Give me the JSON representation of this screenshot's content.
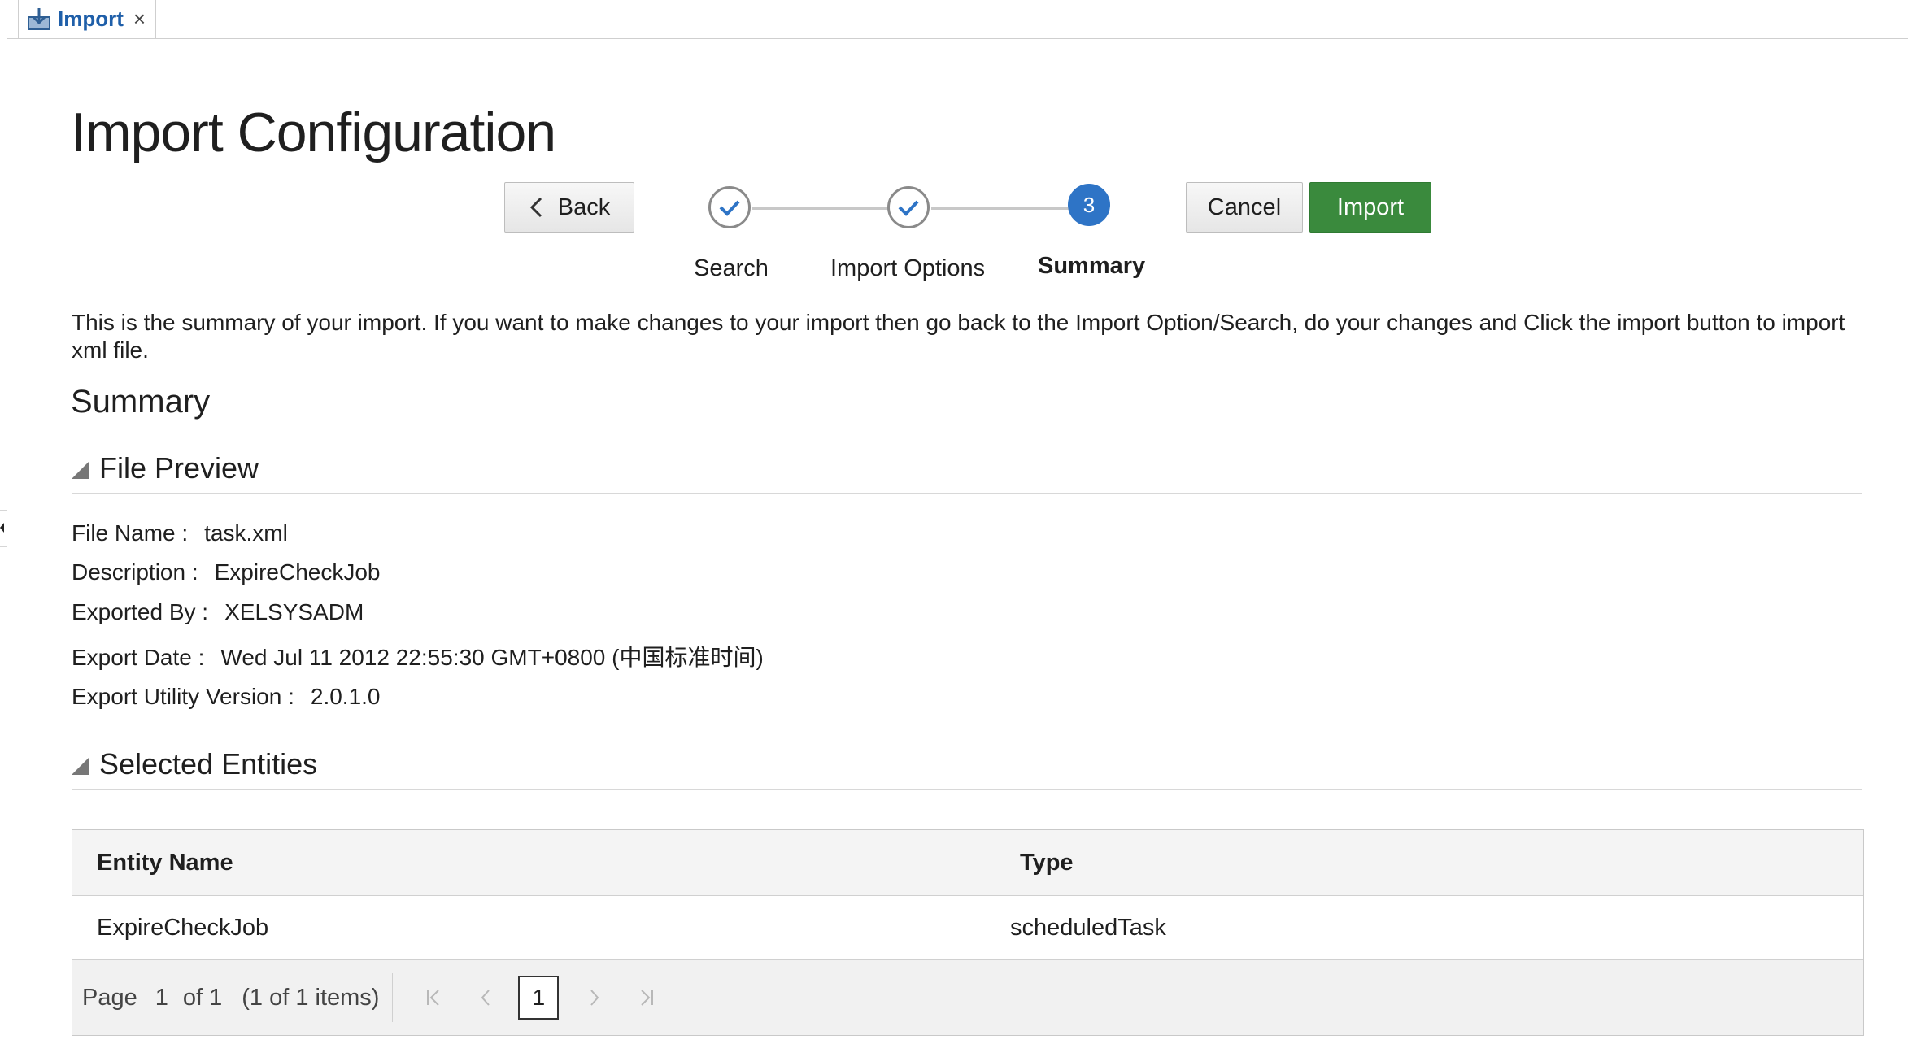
{
  "tab": {
    "label": "Import",
    "close": "×",
    "icon": "import-tray-icon"
  },
  "page": {
    "title": "Import Configuration"
  },
  "buttons": {
    "back": "Back",
    "cancel": "Cancel",
    "import": "Import"
  },
  "train": {
    "steps": [
      {
        "label": "Search",
        "state": "done",
        "icon": "checkmark-icon"
      },
      {
        "label": "Import Options",
        "state": "done",
        "icon": "checkmark-icon"
      },
      {
        "label": "Summary",
        "state": "current",
        "number": "3"
      }
    ]
  },
  "intro": "This is the summary of your import. If you want to make changes to your import then go back to the Import Option/Search, do your changes and Click the import button to import xml file.",
  "summary": {
    "title": "Summary",
    "file_preview": {
      "title": "File Preview",
      "fields": [
        {
          "label": "File Name :",
          "value": "task.xml"
        },
        {
          "label": "Description :",
          "value": "ExpireCheckJob"
        },
        {
          "label": "Exported By :",
          "value": "XELSYSADM"
        },
        {
          "label": "Export Date :",
          "value": "Wed Jul 11 2012 22:55:30 GMT+0800 (中国标准时间)"
        },
        {
          "label": "Export Utility Version :",
          "value": "2.0.1.0"
        }
      ]
    },
    "selected_entities": {
      "title": "Selected Entities",
      "columns": [
        "Entity Name",
        "Type"
      ],
      "rows": [
        [
          "ExpireCheckJob",
          "scheduledTask"
        ]
      ],
      "pager": {
        "page_label": "Page",
        "page": "1",
        "of": "of 1",
        "items": "(1 of 1 items)",
        "current": "1"
      }
    }
  },
  "colors": {
    "accent": "#2e74c6",
    "import_button": "#3a8a3d",
    "tab_text": "#1f5fa9"
  }
}
